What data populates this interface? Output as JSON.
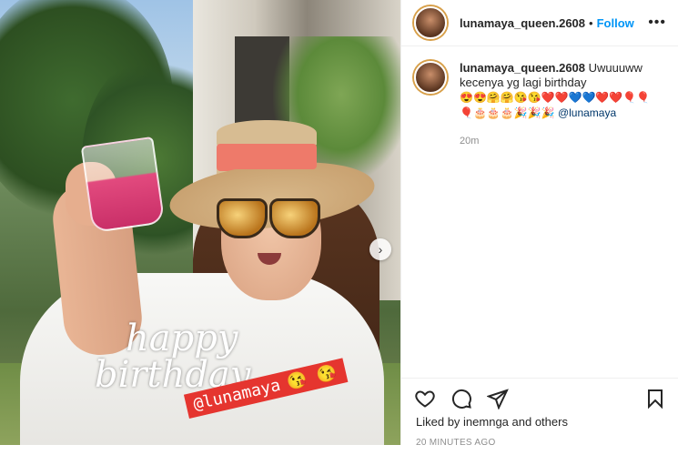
{
  "post": {
    "username": "lunamaya_queen.2608",
    "follow_label": "Follow",
    "more_label": "•••",
    "caption_user": "lunamaya_queen.2608",
    "caption_text": "Uwuuuww kecenya yg lagi birthday",
    "caption_emojis": "😍😍🤗🤗😘😘❤️❤️💙💙❤️❤️🎈🎈🎈🎂🎂🎂🎉🎉🎉",
    "caption_mention": "@lunamaya",
    "comment_time": "20m",
    "liked_by_text": "Liked by inemnga and others",
    "time_ago": "20 MINUTES AGO"
  },
  "media": {
    "sticker_line1": "happy",
    "sticker_line2": "birthday",
    "mention_sticker": "@lunamaya",
    "mention_emojis": "😘 😘",
    "next_arrow": "›"
  }
}
